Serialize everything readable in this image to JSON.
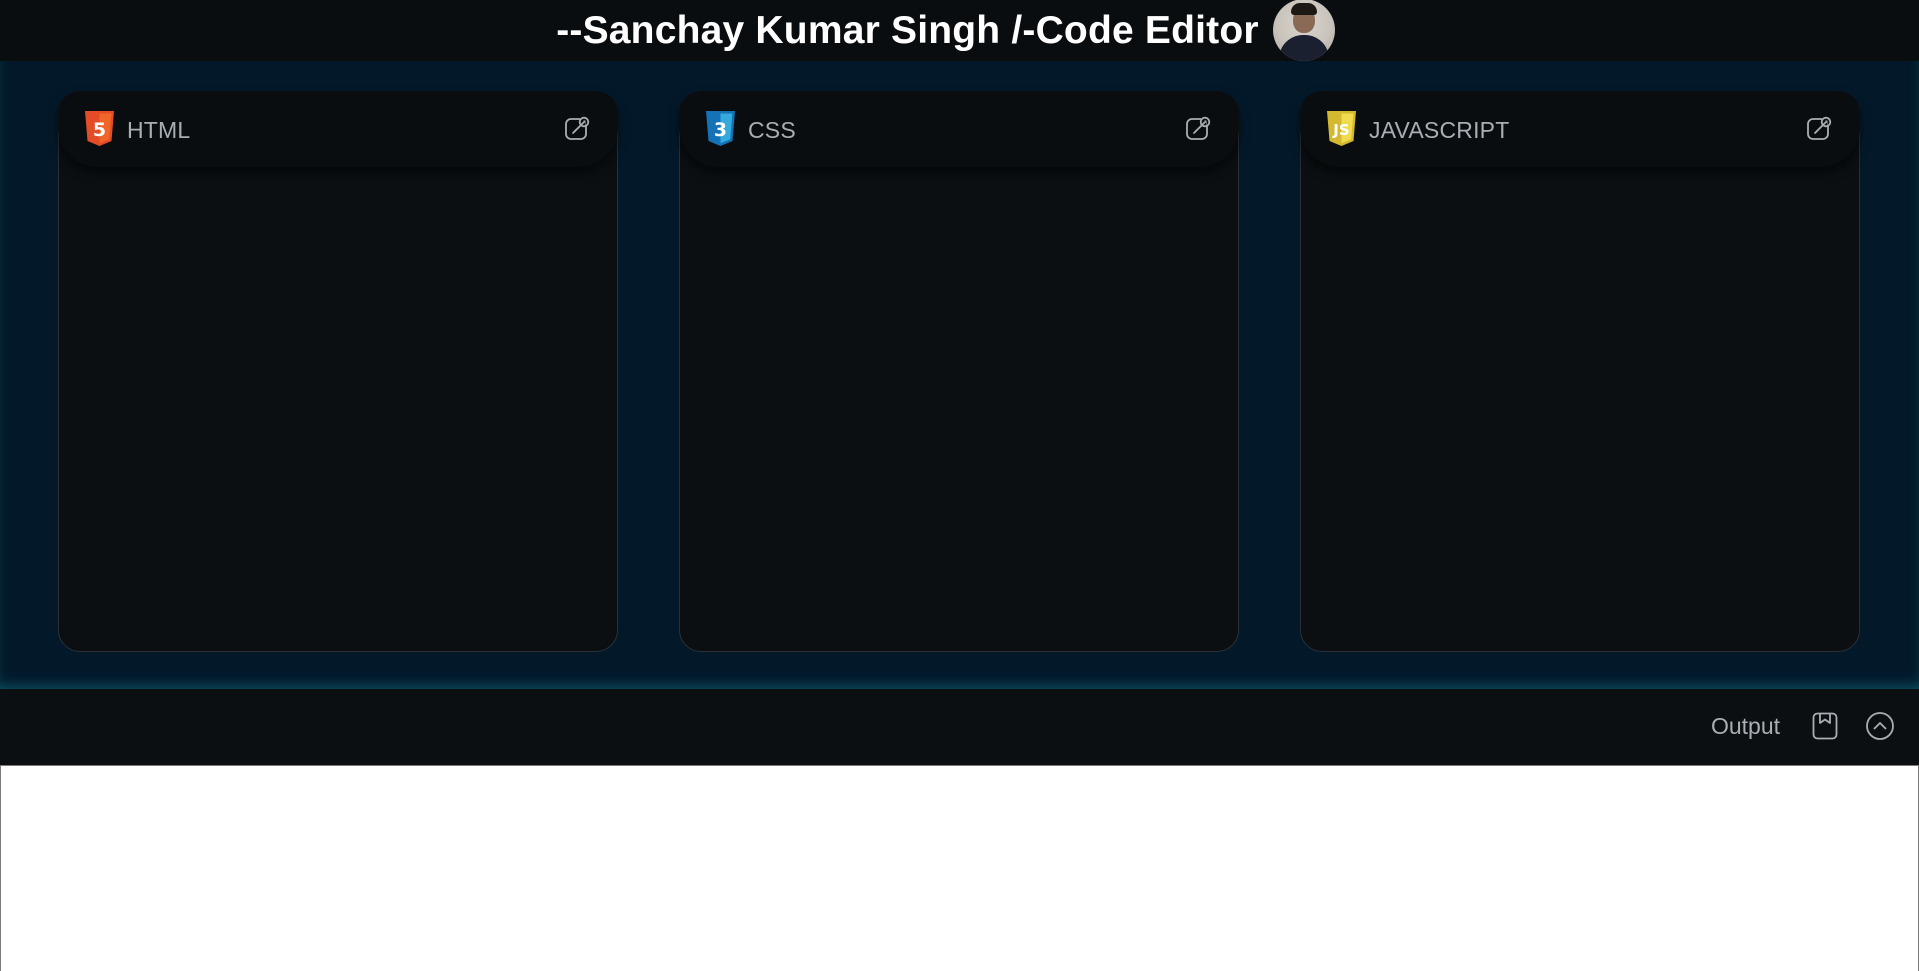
{
  "header": {
    "title": "--Sanchay Kumar Singh /-Code Editor"
  },
  "panels": [
    {
      "label": "HTML",
      "badge_color": "#e34c26",
      "badge_glyph": "5",
      "icon": "html5-icon"
    },
    {
      "label": "CSS",
      "badge_color": "#1572b6",
      "badge_glyph": "3",
      "icon": "css3-icon"
    },
    {
      "label": "JAVASCRIPT",
      "badge_color": "#f0db4f",
      "badge_glyph": "JS",
      "icon": "js-icon"
    }
  ],
  "output_bar": {
    "label": "Output"
  },
  "colors": {
    "page_bg": "#0b0f12",
    "editor_bg": "#03192a",
    "label_text": "#a9aeb3"
  }
}
